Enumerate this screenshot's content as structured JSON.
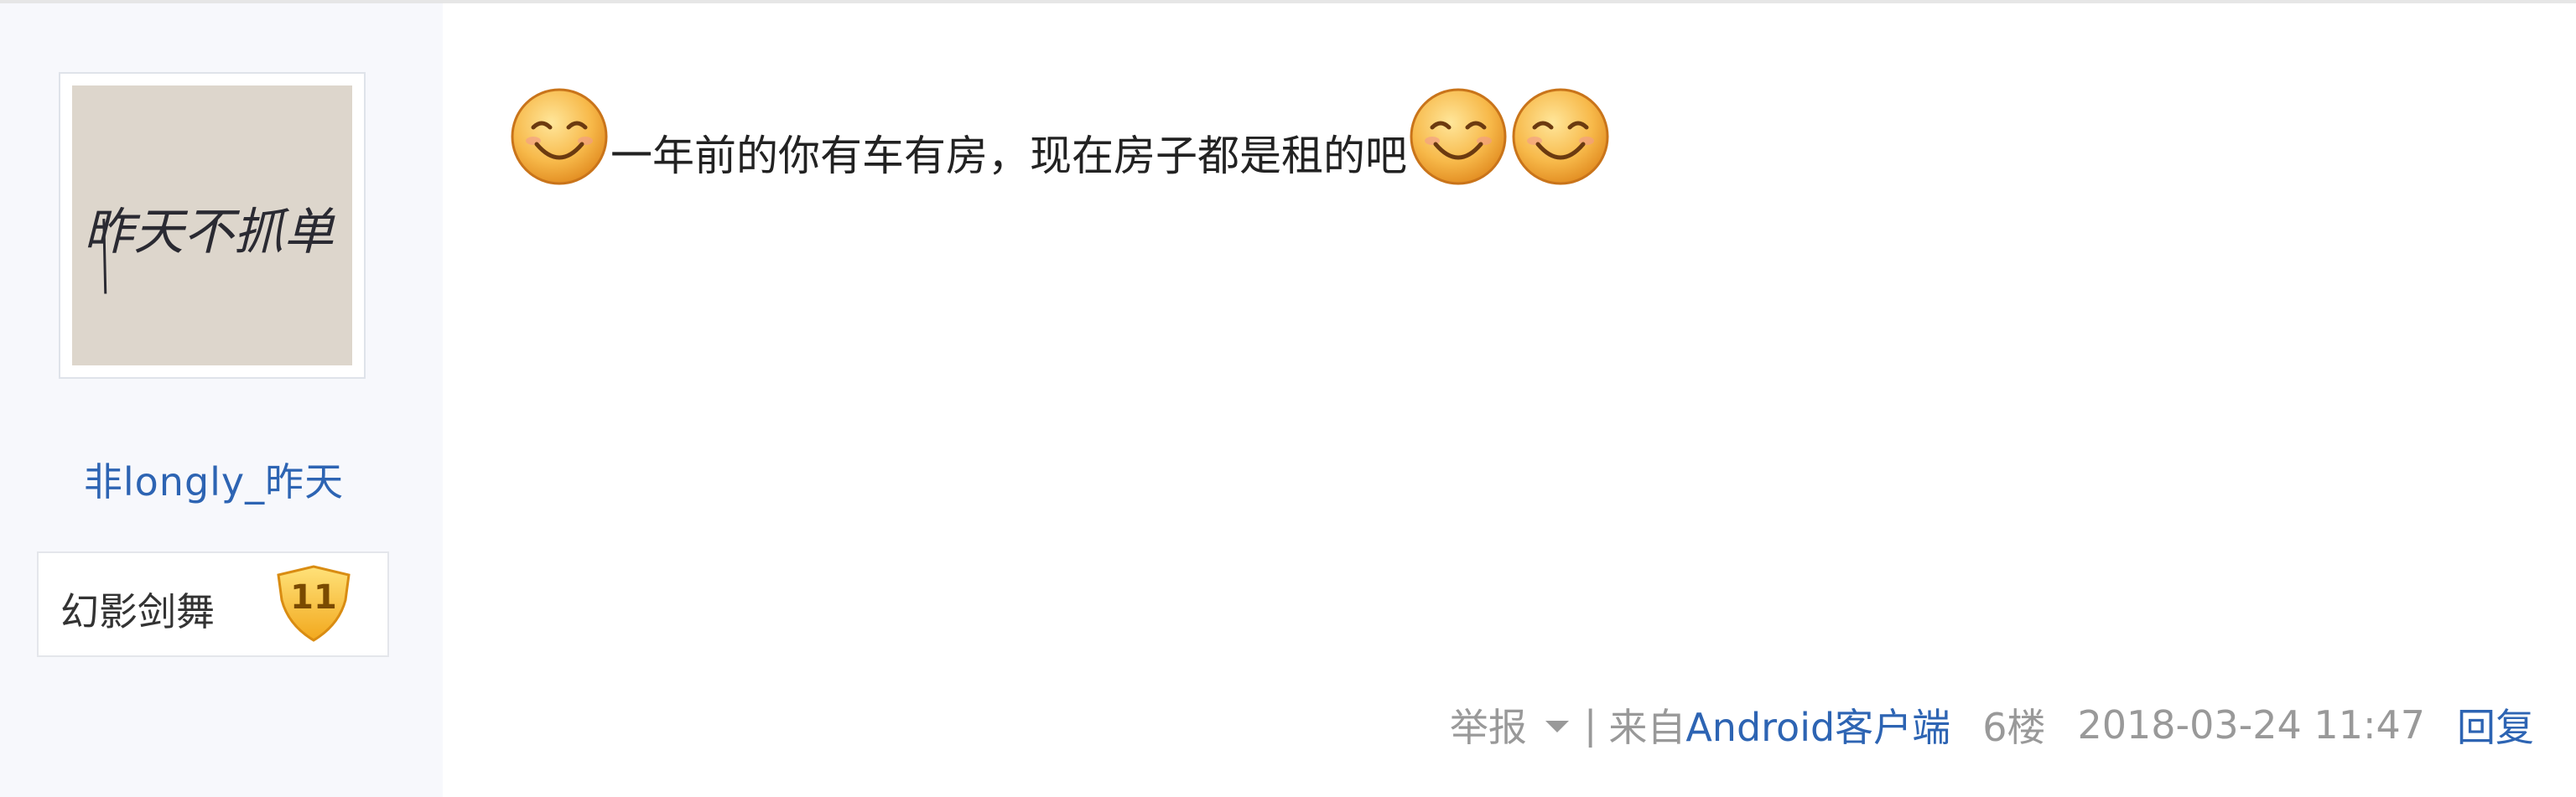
{
  "user": {
    "avatar_text": "昨天不抓单",
    "username": "非longly_昨天",
    "badge_name": "幻影剑舞",
    "badge_level": "11"
  },
  "post": {
    "text": "一年前的你有车有房，现在房子都是租的吧",
    "emoji_icon": "smiley-face-icon"
  },
  "footer": {
    "report": "举报",
    "separator": "|",
    "source_prefix": "来自",
    "client": "Android客户端",
    "floor": "6楼",
    "timestamp": "2018-03-24 11:47",
    "reply": "回复"
  },
  "colors": {
    "link": "#2d64b3",
    "meta": "#999999",
    "sidebar_bg": "#f7f8fc"
  }
}
